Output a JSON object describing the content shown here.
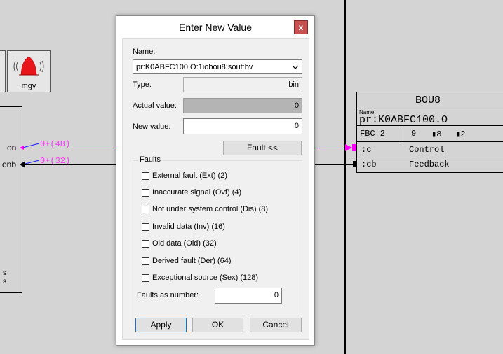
{
  "diagram": {
    "left_icon_label": "mgv",
    "left_signals": [
      {
        "name": "on",
        "value": "0+(48)"
      },
      {
        "name": "onb",
        "value": "0+(32)"
      }
    ],
    "left_block_bottom_text": [
      "s",
      "s"
    ],
    "function_block": {
      "type": "BOU8",
      "name_caption": "Name",
      "name": "pr:K0ABFC100.O",
      "fbc_label": "FBC 2",
      "fbc_cells": [
        "9",
        "▮8",
        "▮2"
      ],
      "ports": [
        {
          "pin": ":c",
          "label": "Control"
        },
        {
          "pin": ":cb",
          "label": "Feedback"
        }
      ]
    },
    "colors": {
      "signal_active": "#ff00ff",
      "background": "#d4d4d4"
    }
  },
  "dialog": {
    "title": "Enter New Value",
    "close_symbol": "x",
    "name_label": "Name:",
    "name_value": "pr:K0ABFC100.O:1iobou8:sout:bv",
    "type_label": "Type:",
    "type_value": "bin",
    "actual_label": "Actual value:",
    "actual_value": "0",
    "new_label": "New value:",
    "new_value": "0",
    "fault_button": "Fault <<",
    "faults_group_label": "Faults",
    "faults": [
      {
        "label": "External fault (Ext) (2)",
        "checked": false
      },
      {
        "label": "Inaccurate signal (Ovf) (4)",
        "checked": false
      },
      {
        "label": "Not under system control (Dis) (8)",
        "checked": false
      },
      {
        "label": "Invalid data (Inv) (16)",
        "checked": false
      },
      {
        "label": "Old data (Old) (32)",
        "checked": false
      },
      {
        "label": "Derived fault (Der) (64)",
        "checked": false
      },
      {
        "label": "Exceptional source (Sex) (128)",
        "checked": false
      }
    ],
    "faults_number_label": "Faults as number:",
    "faults_number_value": "0",
    "buttons": {
      "apply": "Apply",
      "ok": "OK",
      "cancel": "Cancel"
    }
  }
}
